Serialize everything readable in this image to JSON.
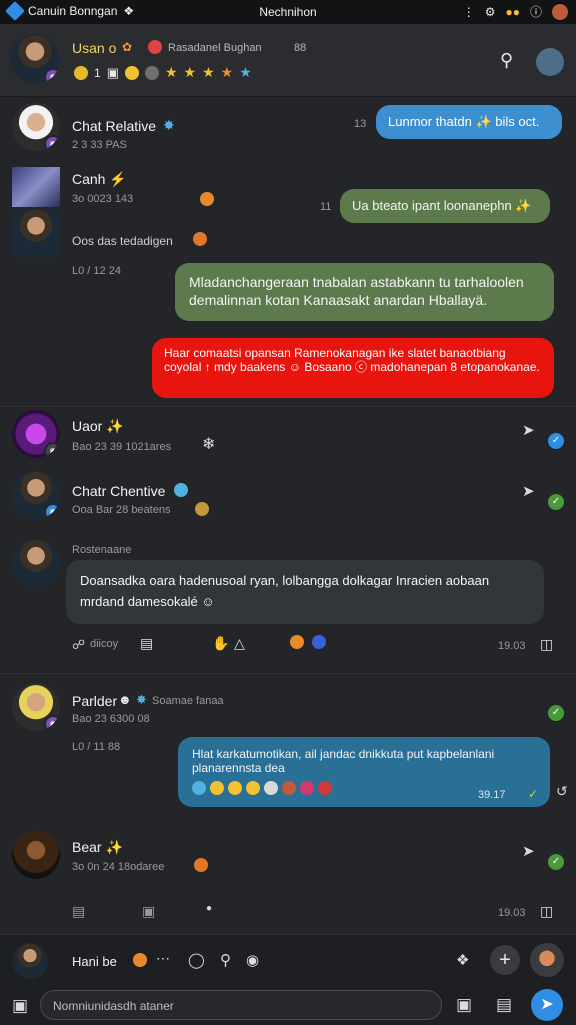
{
  "status": {
    "app_title": "Canuin Bonngan",
    "center_title": "Nechnihon",
    "right_icons": [
      "more-icon",
      "settings-icon",
      "toggle-icon",
      "info-icon",
      "profile-icon"
    ]
  },
  "top": {
    "name": "Usan o",
    "subtitle": "Rasadanel Bughan",
    "count": "88",
    "counter": "1",
    "search_icon": "search-icon"
  },
  "items": [
    {
      "name": "Chat Relative",
      "meta": "2 3 33 PAS",
      "time": "13",
      "bubble": "Lunmor thatdn ✨ bils oct."
    },
    {
      "name": "Canh ⚡",
      "meta": "3o 0023 143",
      "time": "11",
      "bubble": "Ua bteato ipant loonanephn ✨"
    },
    {
      "name": "Oos das tedadigen",
      "meta": "L0 / 12 24"
    },
    {
      "bubble": "Mladanchangeraan tnabalan astabkann tu tarhaloolen demalinnan kotan Kanaasakt anardan Hballayä."
    },
    {
      "bubble": "Haar comaatsi opansan Ramenokanagan ike slatet banaotbiang coyolal ↑ mdy baakens ☺ Bosaano ⓒ madohanepan 8 etopanokanae."
    },
    {
      "name": "Uaor ✨",
      "meta": "Bao 23 39 1021ares"
    },
    {
      "name": "Chatr Chentive",
      "meta": "Ooa Bar 28 beatens"
    },
    {
      "label": "Rostenaane",
      "bubble": "Doansadka oara hadenusoal ryan, lolbangga dolkagar Inracien aobaan mrdand damesokalé ☺",
      "action": "diicoy",
      "time": "19.03"
    },
    {
      "name": "Parlder",
      "tag": "Soamae fanaa",
      "meta": "Bao 23 6300 08",
      "meta2": "L0 / 11 88",
      "bubble": "Hlat karkatumotikan, ail jandac dnikkuta put kapbelanlani planarennsta dea",
      "time": "39.17"
    },
    {
      "name": "Bear ✨",
      "meta": "3o 0n 24 18odaree",
      "bottom_time": "19.03"
    }
  ],
  "composer": {
    "name": "Hani be",
    "placeholder": "Nomniunidasdh ataner"
  },
  "colors": {
    "accent": "#2f8de4",
    "bubble_blue": "#3d8fd0",
    "bubble_green": "#5d7a4c",
    "bubble_red": "#e8150f",
    "bubble_teal": "#2a6f96"
  }
}
